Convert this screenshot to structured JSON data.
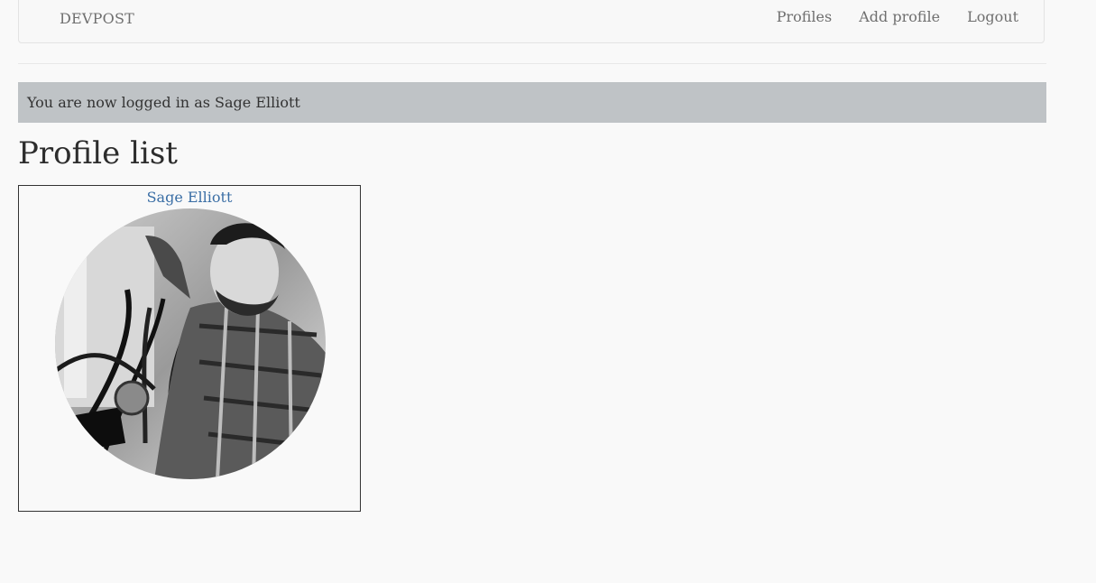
{
  "navbar": {
    "brand": "DEVPOST",
    "links": [
      "Profiles",
      "Add profile",
      "Logout"
    ]
  },
  "flash": {
    "message": "You are now logged in as Sage Elliott"
  },
  "page": {
    "title": "Profile list"
  },
  "profiles": [
    {
      "name": "Sage Elliott",
      "avatar_icon": "profile-photo"
    }
  ],
  "colors": {
    "flash_bg": "#bfc3c6",
    "link": "#3a6ea5",
    "nav_text": "#6f6f6f"
  }
}
